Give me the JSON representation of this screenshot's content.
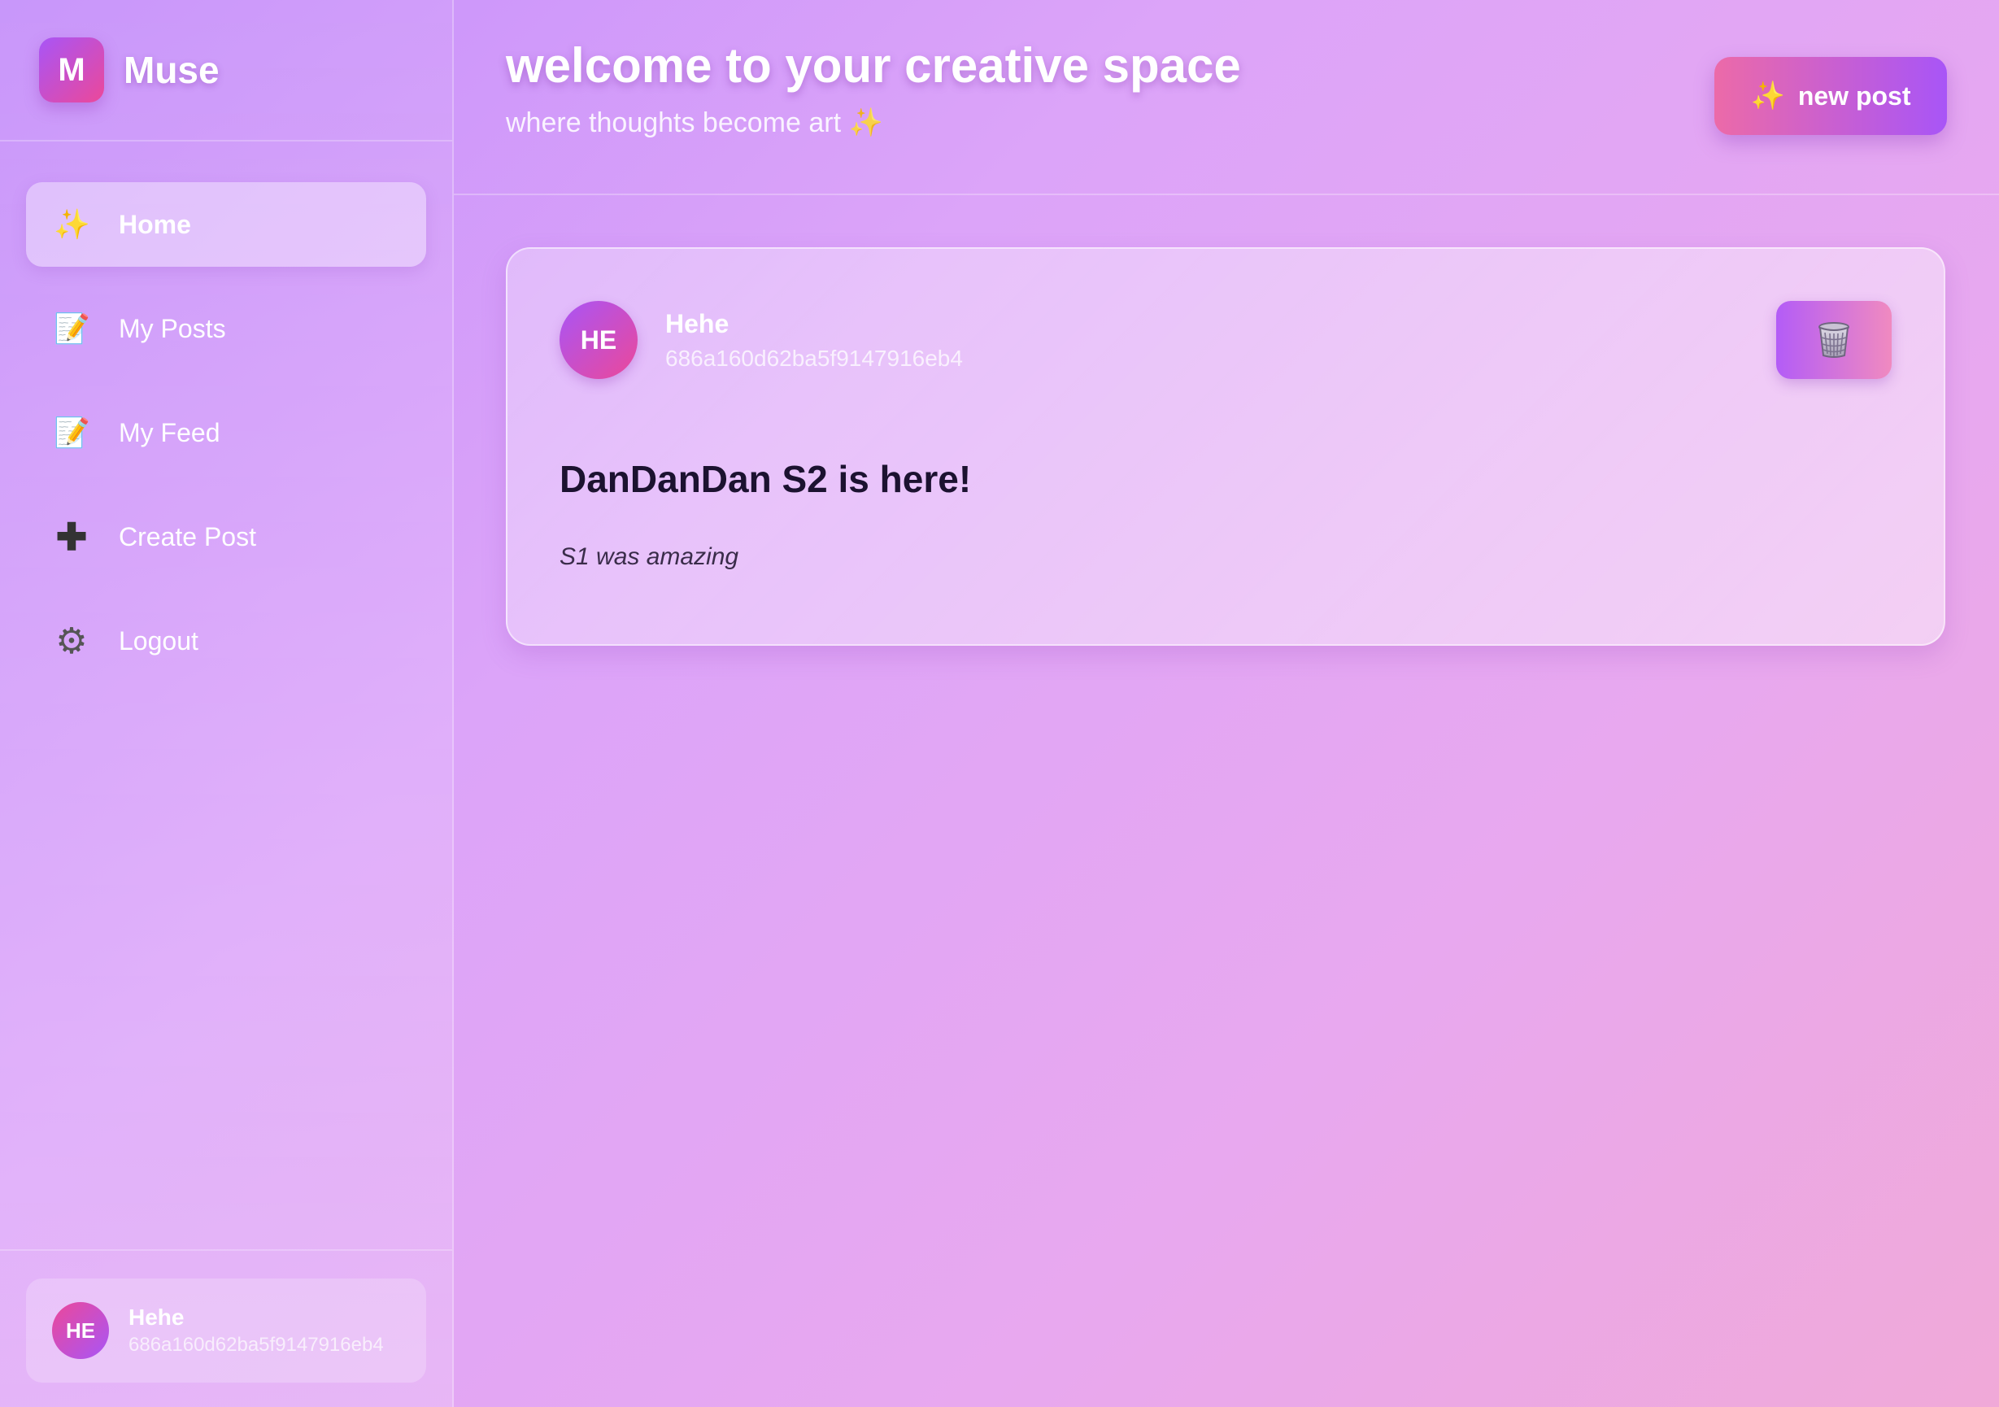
{
  "brand": {
    "logo_letter": "M",
    "name": "Muse"
  },
  "nav": {
    "items": [
      {
        "icon": "sparkles-icon",
        "glyph": "✨",
        "label": "Home",
        "active": true
      },
      {
        "icon": "memo-icon",
        "glyph": "📝",
        "label": "My Posts",
        "active": false
      },
      {
        "icon": "memo-icon",
        "glyph": "📝",
        "label": "My Feed",
        "active": false
      },
      {
        "icon": "plus-icon",
        "glyph": "✚",
        "label": "Create Post",
        "active": false
      },
      {
        "icon": "gear-icon",
        "glyph": "⚙",
        "label": "Logout",
        "active": false
      }
    ]
  },
  "current_user": {
    "initials": "HE",
    "name": "Hehe",
    "id": "686a160d62ba5f9147916eb4"
  },
  "header": {
    "title": "welcome to your creative space",
    "subtitle": "where thoughts become art ✨",
    "new_post_icon": "✨",
    "new_post_label": "new post"
  },
  "posts": [
    {
      "author_initials": "HE",
      "author_name": "Hehe",
      "author_id": "686a160d62ba5f9147916eb4",
      "delete_icon": "trash-icon",
      "title": "DanDanDan S2 is here!",
      "body": "S1 was amazing"
    }
  ],
  "colors": {
    "accent_purple": "#a855f7",
    "accent_pink": "#ec4899"
  }
}
